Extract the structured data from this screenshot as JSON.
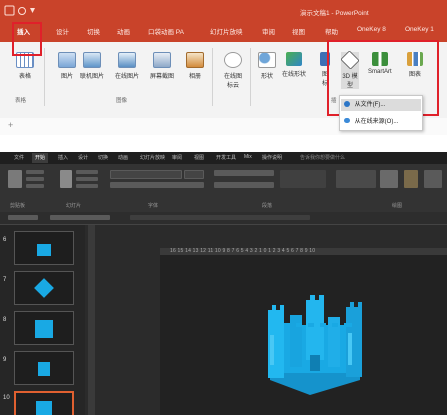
{
  "top_window": {
    "title": "演示文稿1 - PowerPoint",
    "tabs": [
      "插入",
      "设计",
      "切换",
      "动画",
      "口袋动画 PA",
      "幻灯片放映",
      "审阅",
      "视图",
      "帮助",
      "OneKey 8",
      "OneKey 1"
    ],
    "active_tab": "插入",
    "ribbon_buttons": {
      "table": "表格",
      "picture": "图片",
      "online_picture_1": "联机图片",
      "online_picture_2": "在线图片",
      "screenshot": "屏幕截图",
      "album": "相册",
      "online_icon": "在线图标云",
      "shapes": "形状",
      "online_shapes": "在线形状",
      "icons": "图标",
      "model_3d": "3D 模型",
      "smartart": "SmartArt",
      "chart": "图表"
    },
    "group_labels": {
      "tables": "表格",
      "images": "图像",
      "illustrations": "插"
    },
    "dropdown": {
      "from_file": "从文件(F)...",
      "from_online": "从在线来源(O)..."
    }
  },
  "bottom_window": {
    "tabs": [
      "文件",
      "开始",
      "插入",
      "设计",
      "切换",
      "动画",
      "幻灯片放映",
      "审阅",
      "视图",
      "开发工具",
      "Mix",
      "操作说明"
    ],
    "active_tab": "开始",
    "search_hint": "告诉我你想要做什么",
    "group_labels": [
      "剪贴板",
      "幻灯片",
      "字体",
      "段落",
      "绘图"
    ],
    "ruler_numbers": "16 15 14 13 12 11 10 9 8 7 6 5 4 3 2 1 0 1 2 3 4 5 6 7 8 9 10",
    "thumbnails": [
      {
        "number": "6"
      },
      {
        "number": "7"
      },
      {
        "number": "8"
      },
      {
        "number": "9"
      },
      {
        "number": "10"
      }
    ]
  },
  "colors": {
    "ppt_accent": "#c9432a",
    "highlight_red": "#e0202a",
    "model_cyan": "#19a9e4",
    "dark_bg": "#2b2b2b"
  }
}
